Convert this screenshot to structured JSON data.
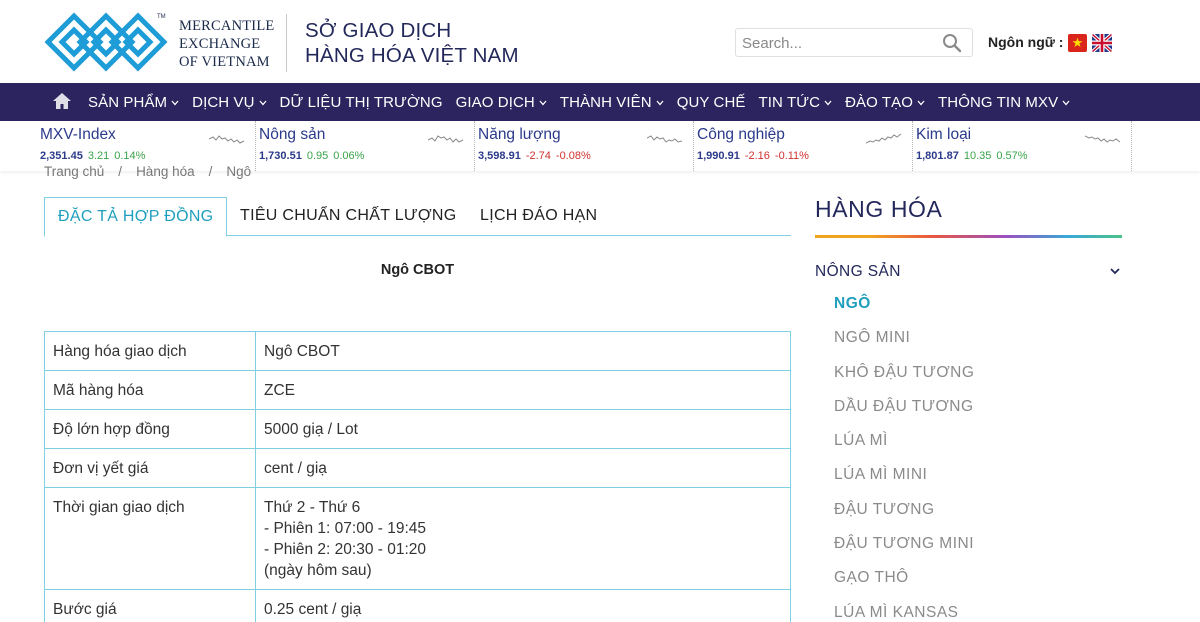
{
  "header": {
    "logo_lines": [
      "MERCANTILE",
      "EXCHANGE",
      "OF VIETNAM"
    ],
    "logo_tm": "TM",
    "brand_lines": [
      "SỞ GIAO DỊCH",
      "HÀNG HÓA VIỆT NAM"
    ],
    "search_placeholder": "Search...",
    "language_label": "Ngôn ngữ :",
    "colors": {
      "brand": "#23285b",
      "logo": "#1e9cd7"
    }
  },
  "nav": {
    "home_icon": "home-icon",
    "items": [
      {
        "label": "SẢN PHẨM",
        "dropdown": true
      },
      {
        "label": "DỊCH VỤ",
        "dropdown": true
      },
      {
        "label": "DỮ LIỆU THỊ TRƯỜNG",
        "dropdown": false
      },
      {
        "label": "GIAO DỊCH",
        "dropdown": true
      },
      {
        "label": "THÀNH VIÊN",
        "dropdown": true
      },
      {
        "label": "QUY CHẾ",
        "dropdown": false
      },
      {
        "label": "TIN TỨC",
        "dropdown": true
      },
      {
        "label": "ĐÀO TẠO",
        "dropdown": true
      },
      {
        "label": "THÔNG TIN MXV",
        "dropdown": true
      }
    ],
    "chevron": "⌄",
    "colors": {
      "background": "#2b245e"
    }
  },
  "ticker": [
    {
      "name": "MXV-Index",
      "value": "2,351.45",
      "change": "3.21",
      "percent": "0.14%",
      "direction": "up"
    },
    {
      "name": "Nông sản",
      "value": "1,730.51",
      "change": "0.95",
      "percent": "0.06%",
      "direction": "up"
    },
    {
      "name": "Năng lượng",
      "value": "3,598.91",
      "change": "-2.74",
      "percent": "-0.08%",
      "direction": "down"
    },
    {
      "name": "Công nghiệp",
      "value": "1,990.91",
      "change": "-2.16",
      "percent": "-0.11%",
      "direction": "down"
    },
    {
      "name": "Kim loại",
      "value": "1,801.87",
      "change": "10.35",
      "percent": "0.57%",
      "direction": "up"
    }
  ],
  "breadcrumb": [
    "Trang chủ",
    "/",
    "Hàng hóa",
    "/",
    "Ngô"
  ],
  "tabs": [
    {
      "label": "ĐẶC TẢ HỢP ĐỒNG",
      "active": true
    },
    {
      "label": "TIÊU CHUẨN CHẤT LƯỢNG",
      "active": false
    },
    {
      "label": "LỊCH ĐÁO HẠN",
      "active": false
    }
  ],
  "content": {
    "title": "Ngô CBOT",
    "rows": [
      {
        "key": "Hàng hóa giao dịch",
        "value": [
          "Ngô CBOT"
        ]
      },
      {
        "key": "Mã hàng hóa",
        "value": [
          "ZCE"
        ]
      },
      {
        "key": "Độ lớn hợp đồng",
        "value": [
          "5000 giạ / Lot"
        ]
      },
      {
        "key": "Đơn vị yết giá",
        "value": [
          "cent / giạ"
        ]
      },
      {
        "key": "Thời gian giao dịch",
        "value": [
          "Thứ 2 - Thứ 6",
          "- Phiên 1: 07:00 - 19:45",
          "- Phiên 2: 20:30 - 01:20",
          "(ngày hôm sau)"
        ]
      },
      {
        "key": "Bước giá",
        "value": [
          "0.25 cent / giạ"
        ]
      }
    ]
  },
  "sidebar": {
    "title": "HÀNG HÓA",
    "category": "NÔNG SẢN",
    "category_chevron": "⌄",
    "items": [
      {
        "label": "NGÔ",
        "active": true
      },
      {
        "label": "NGÔ MINI",
        "active": false
      },
      {
        "label": "KHÔ ĐẬU TƯƠNG",
        "active": false
      },
      {
        "label": "DẦU ĐẬU TƯƠNG",
        "active": false
      },
      {
        "label": "LÚA MÌ",
        "active": false
      },
      {
        "label": "LÚA MÌ MINI",
        "active": false
      },
      {
        "label": "ĐẬU TƯƠNG",
        "active": false
      },
      {
        "label": "ĐẬU TƯƠNG MINI",
        "active": false
      },
      {
        "label": "GẠO THÔ",
        "active": false
      },
      {
        "label": "LÚA MÌ KANSAS",
        "active": false
      }
    ],
    "colors": {
      "active": "#1f9fbd",
      "inactive": "#8a8a8a"
    }
  }
}
